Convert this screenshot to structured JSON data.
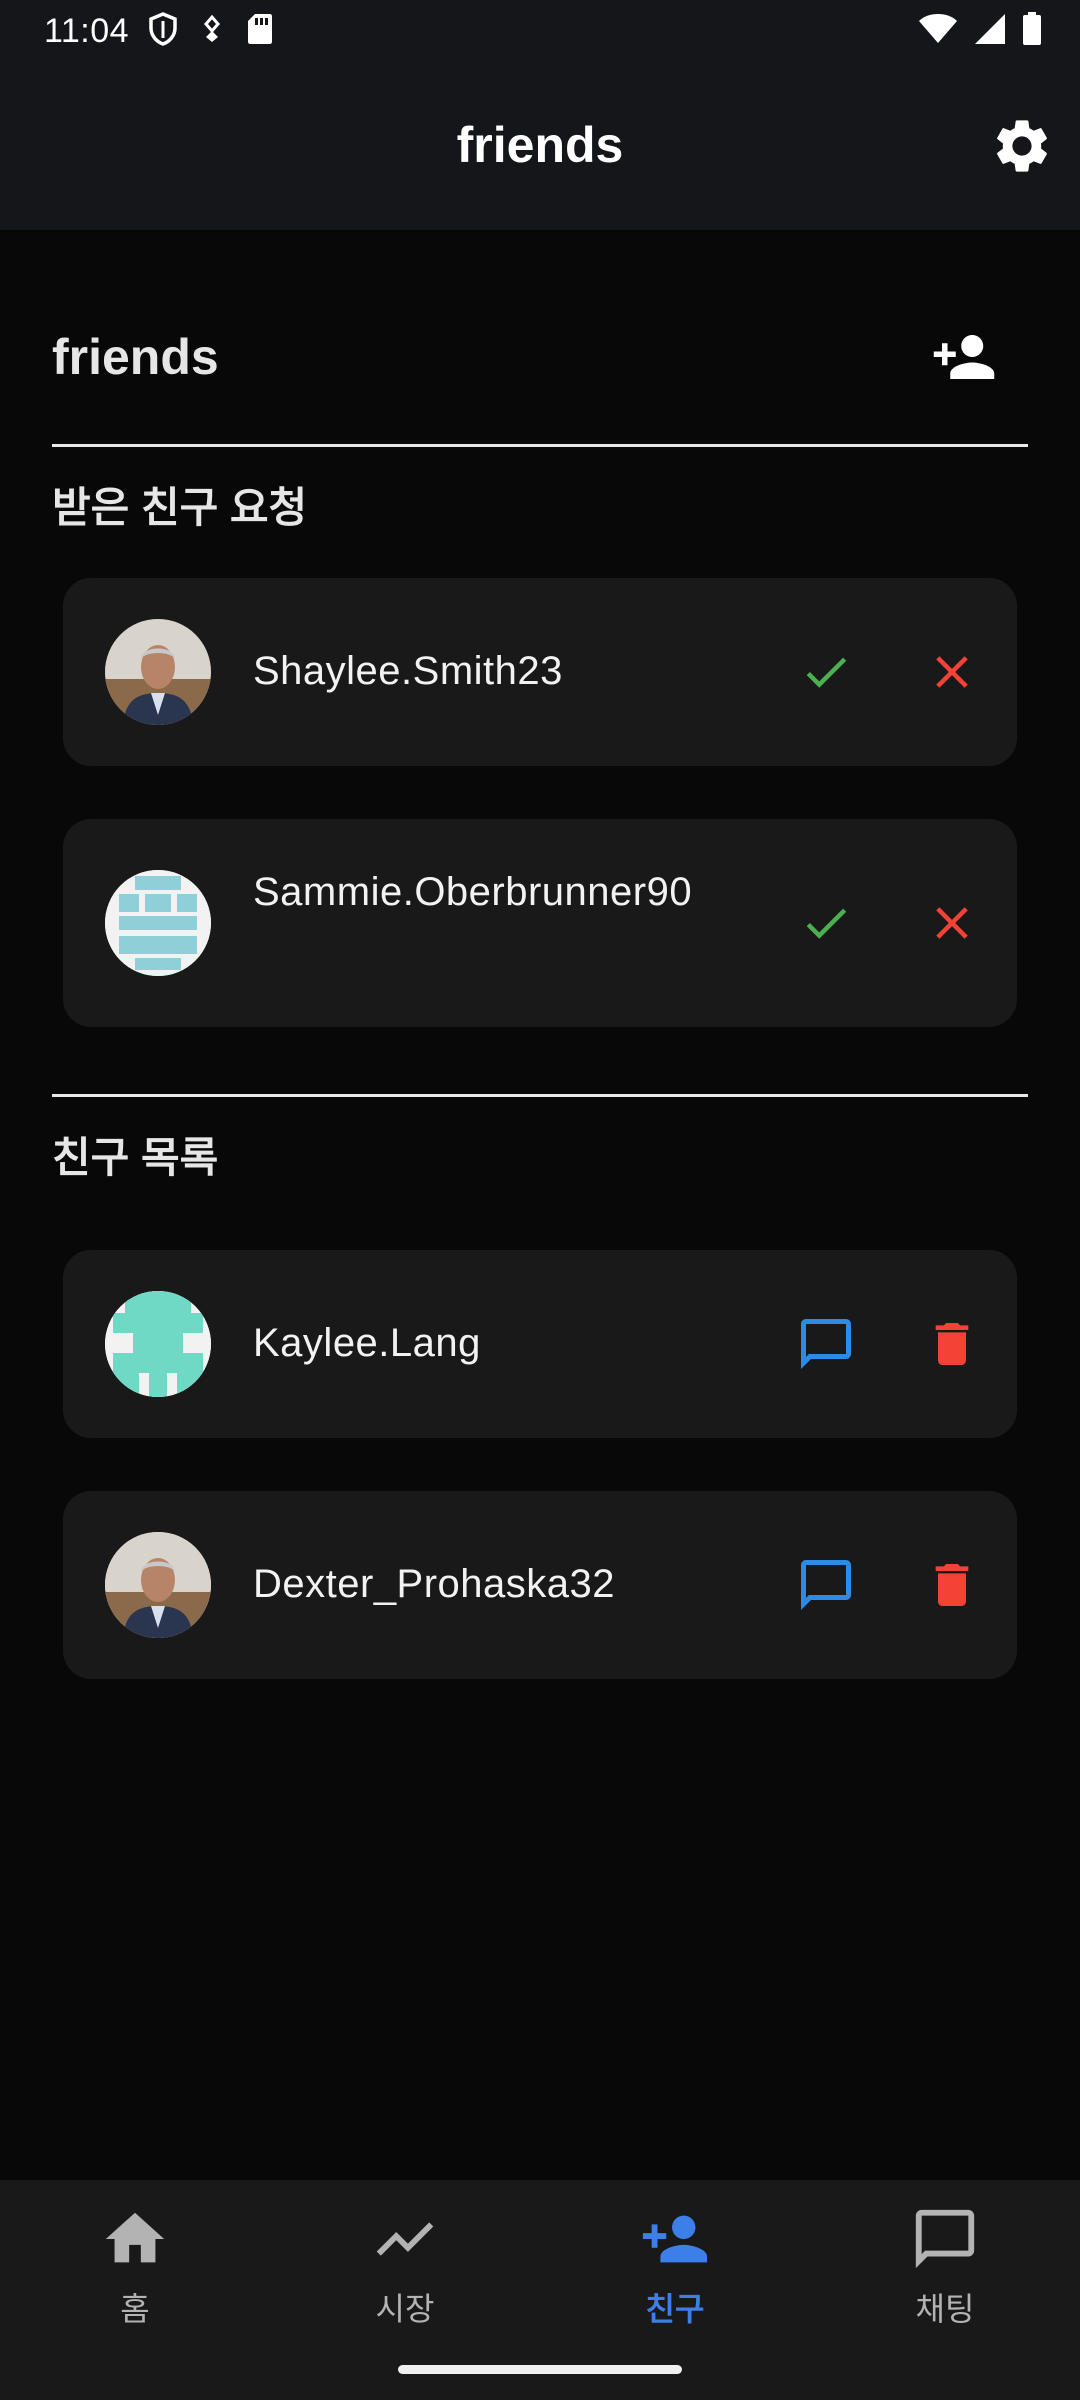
{
  "status_bar": {
    "time": "11:04",
    "left_icons": [
      "shield-icon",
      "gesture-icon",
      "sd-card-icon"
    ],
    "right_icons": [
      "wifi-icon",
      "signal-icon",
      "battery-icon"
    ]
  },
  "app_bar": {
    "title": "friends",
    "settings_icon": "gear-icon"
  },
  "header": {
    "title": "friends",
    "add_icon": "person-add-icon"
  },
  "requests": {
    "title": "받은 친구 요청",
    "items": [
      {
        "name": "Shaylee.Smith23",
        "avatar": "photo",
        "accept_icon": "check-icon",
        "reject_icon": "close-icon"
      },
      {
        "name": "Sammie.Oberbrunner90",
        "avatar": "identicon-lightblue",
        "accept_icon": "check-icon",
        "reject_icon": "close-icon"
      }
    ]
  },
  "friends": {
    "title": "친구 목록",
    "items": [
      {
        "name": "Kaylee.Lang",
        "avatar": "identicon-teal",
        "chat_icon": "chat-icon",
        "delete_icon": "trash-icon"
      },
      {
        "name": "Dexter_Prohaska32",
        "avatar": "photo",
        "chat_icon": "chat-icon",
        "delete_icon": "trash-icon"
      }
    ]
  },
  "bottom_nav": {
    "items": [
      {
        "label": "홈",
        "icon": "home-icon"
      },
      {
        "label": "시장",
        "icon": "trending-icon"
      },
      {
        "label": "친구",
        "icon": "person-add-icon",
        "active": true
      },
      {
        "label": "채팅",
        "icon": "chat-icon"
      }
    ]
  },
  "colors": {
    "accent": "#3d7fe8",
    "accept": "#4caf50",
    "reject": "#f44336",
    "chat": "#2b8be6"
  }
}
